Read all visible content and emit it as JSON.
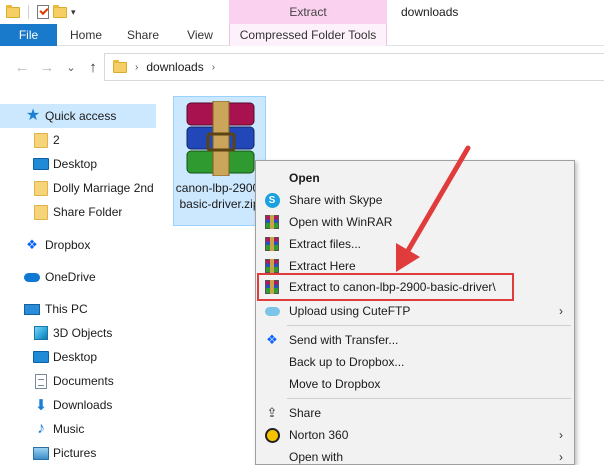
{
  "quick_access_toolbar": {
    "icons": [
      "folder-icon",
      "properties-check-icon",
      "new-folder-icon",
      "customize-dropdown-icon"
    ],
    "dropdown_glyph": "▾"
  },
  "window": {
    "title": "downloads",
    "contextual_tab_group": "Extract"
  },
  "ribbon": {
    "tabs": [
      "File",
      "Home",
      "Share",
      "View",
      "Compressed Folder Tools"
    ],
    "file_tab_color": "#1979ca"
  },
  "address_bar": {
    "back": "←",
    "forward": "→",
    "recent": "⌄",
    "up": "↑",
    "path": "downloads",
    "chevron": "›"
  },
  "sidebar": {
    "items": [
      {
        "label": "Quick access",
        "icon": "star-icon"
      },
      {
        "label": "2",
        "icon": "folder-icon"
      },
      {
        "label": "Desktop",
        "icon": "desktop-icon"
      },
      {
        "label": "Dolly Marriage 2nd",
        "icon": "folder-icon"
      },
      {
        "label": "Share Folder",
        "icon": "folder-icon"
      },
      {
        "label": "Dropbox",
        "icon": "dropbox-icon"
      },
      {
        "label": "OneDrive",
        "icon": "onedrive-icon"
      },
      {
        "label": "This PC",
        "icon": "pc-icon"
      },
      {
        "label": "3D Objects",
        "icon": "cube-icon"
      },
      {
        "label": "Desktop",
        "icon": "desktop-icon"
      },
      {
        "label": "Documents",
        "icon": "documents-icon"
      },
      {
        "label": "Downloads",
        "icon": "download-icon"
      },
      {
        "label": "Music",
        "icon": "music-icon"
      },
      {
        "label": "Pictures",
        "icon": "pictures-icon"
      }
    ],
    "selected_color": "#cce8ff"
  },
  "file": {
    "name": "canon-lbp-2900-basic-driver.zip",
    "icon": "winrar-archive-icon"
  },
  "context_menu": {
    "items": [
      {
        "label": "Open",
        "icon": "",
        "bold": true,
        "submenu": false
      },
      {
        "label": "Share with Skype",
        "icon": "skype-icon",
        "submenu": false
      },
      {
        "label": "Open with WinRAR",
        "icon": "winrar-icon",
        "submenu": false
      },
      {
        "label": "Extract files...",
        "icon": "winrar-icon",
        "submenu": false
      },
      {
        "label": "Extract Here",
        "icon": "winrar-icon",
        "submenu": false
      },
      {
        "label": "Extract to canon-lbp-2900-basic-driver\\",
        "icon": "winrar-icon",
        "submenu": false,
        "highlighted": true
      },
      {
        "label": "Upload using CuteFTP",
        "icon": "cuteftp-icon",
        "submenu": true
      },
      {
        "label": "Send with Transfer...",
        "icon": "dropbox-icon",
        "submenu": false
      },
      {
        "label": "Back up to Dropbox...",
        "icon": "",
        "submenu": false
      },
      {
        "label": "Move to Dropbox",
        "icon": "",
        "submenu": false
      },
      {
        "label": "Share",
        "icon": "share-icon",
        "submenu": false
      },
      {
        "label": "Norton 360",
        "icon": "norton-icon",
        "submenu": true
      },
      {
        "label": "Open with",
        "icon": "",
        "submenu": true
      }
    ],
    "submenu_glyph": "›",
    "highlight_color": "#e03c3c"
  },
  "annotation": {
    "arrow_color": "#e03c3c"
  }
}
